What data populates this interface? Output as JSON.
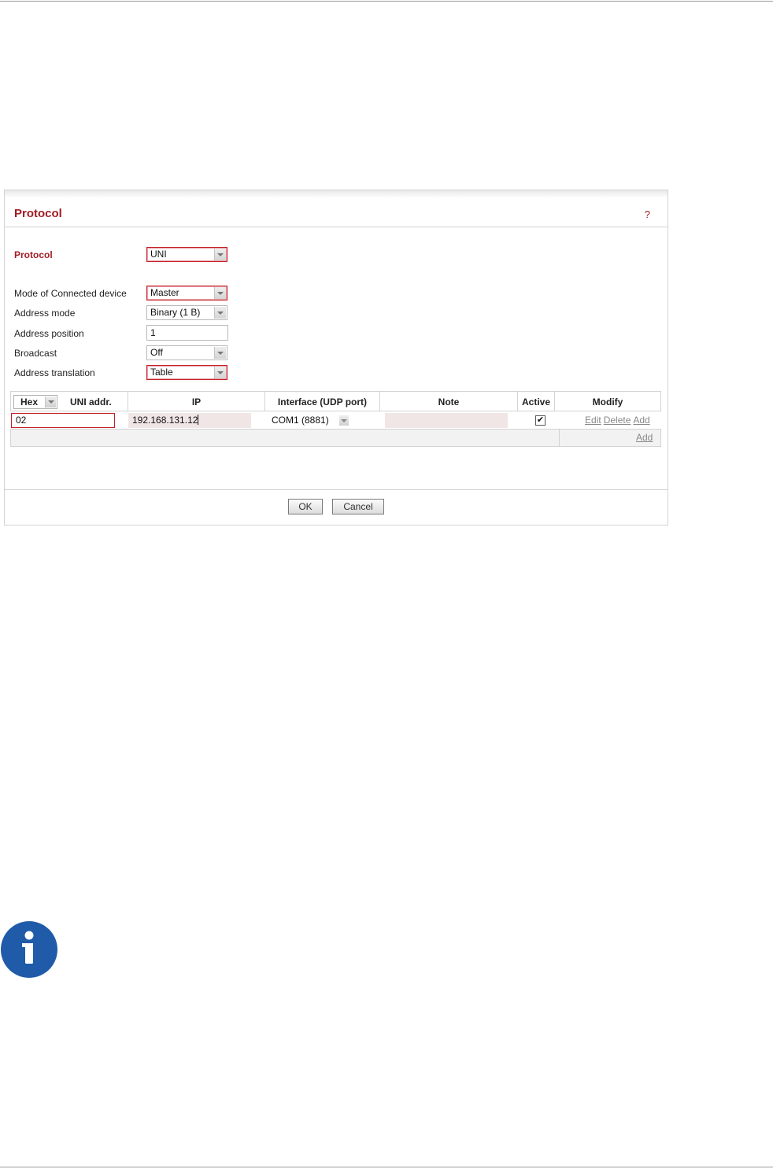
{
  "panel": {
    "title": "Protocol",
    "help": "?"
  },
  "form": {
    "protocol": {
      "label": "Protocol",
      "value": "UNI"
    },
    "mode": {
      "label": "Mode of Connected device",
      "value": "Master"
    },
    "address_mode": {
      "label": "Address mode",
      "value": "Binary (1 B)"
    },
    "address_position": {
      "label": "Address position",
      "value": "1"
    },
    "broadcast": {
      "label": "Broadcast",
      "value": "Off"
    },
    "address_translation": {
      "label": "Address translation",
      "value": "Table"
    }
  },
  "table": {
    "format_select": "Hex",
    "headers": {
      "uni_addr": "UNI addr.",
      "ip": "IP",
      "interface": "Interface (UDP port)",
      "note": "Note",
      "active": "Active",
      "modify": "Modify"
    },
    "rows": [
      {
        "uni_addr": "02",
        "ip": "192.168.131.12",
        "interface": "COM1 (8881)",
        "note": "",
        "active": true,
        "links": {
          "edit": "Edit",
          "delete": "Delete",
          "add": "Add"
        }
      }
    ],
    "footer_add": "Add",
    "checkmark": "✔"
  },
  "buttons": {
    "ok": "OK",
    "cancel": "Cancel"
  },
  "colors": {
    "accent": "#a11c24",
    "info_icon": "#1f5ba8"
  },
  "icons": {
    "info": "info-icon"
  }
}
